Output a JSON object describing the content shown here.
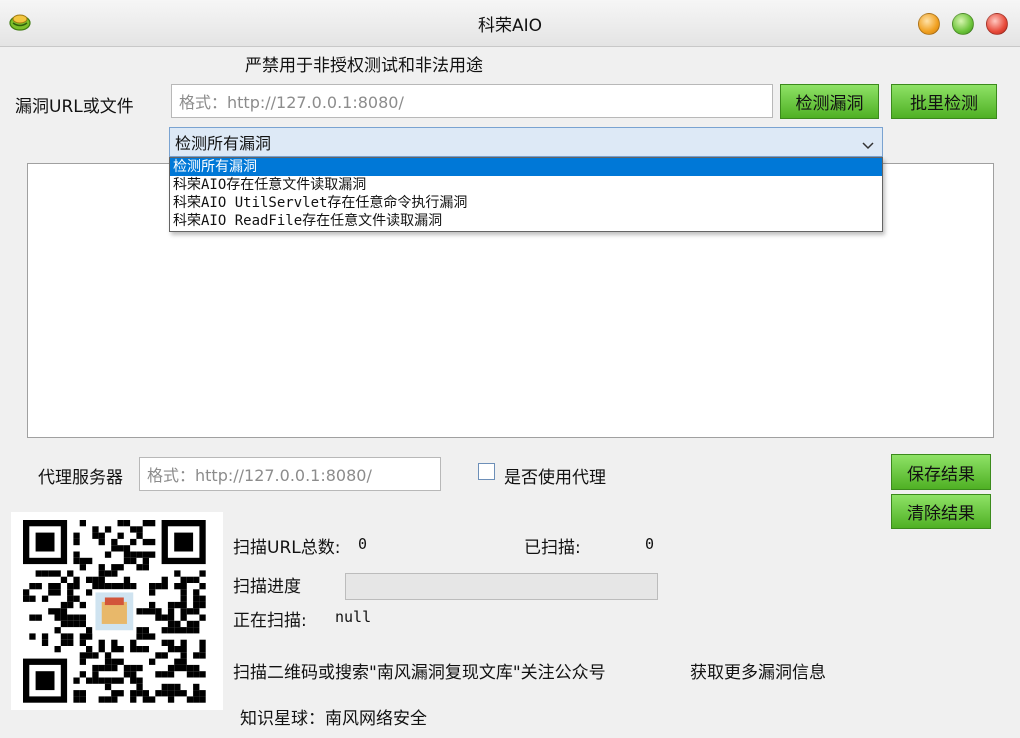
{
  "window": {
    "title": "科荣AIO"
  },
  "warning": "严禁用于非授权测试和非法用途",
  "target": {
    "label": "漏洞URL或文件",
    "placeholder": "格式：http://127.0.0.1:8080/",
    "detect_button": "检测漏洞",
    "batch_button": "批里检测"
  },
  "vuln_select": {
    "selected": "检测所有漏洞",
    "options": [
      "检测所有漏洞",
      "科荣AIO存在任意文件读取漏洞",
      "科荣AIO UtilServlet存在任意命令执行漏洞",
      "科荣AIO ReadFile存在任意文件读取漏洞"
    ]
  },
  "output": {
    "text": ""
  },
  "proxy": {
    "label": "代理服务器",
    "placeholder": "格式：http://127.0.0.1:8080/",
    "checkbox_label": "是否使用代理",
    "checked": false
  },
  "actions": {
    "save": "保存结果",
    "clear": "清除结果"
  },
  "scan": {
    "total_label": "扫描URL总数:",
    "total_value": "0",
    "scanned_label": "已扫描:",
    "scanned_value": "0",
    "progress_label": "扫描进度",
    "progress": 0,
    "current_label": "正在扫描:",
    "current_value": "null"
  },
  "promo": {
    "line1": "扫描二维码或搜索\"南风漏洞复现文库\"关注公众号",
    "line1b": "获取更多漏洞信息",
    "line2": "知识星球：南风网络安全"
  },
  "icons": {
    "app": "app-logo-icon",
    "dropdown": "chevron-down-icon",
    "qr": "qr-code-image"
  },
  "colors": {
    "button_green": "#5cc030",
    "selection_blue": "#0078d7",
    "combo_bg": "#dde9f6"
  }
}
